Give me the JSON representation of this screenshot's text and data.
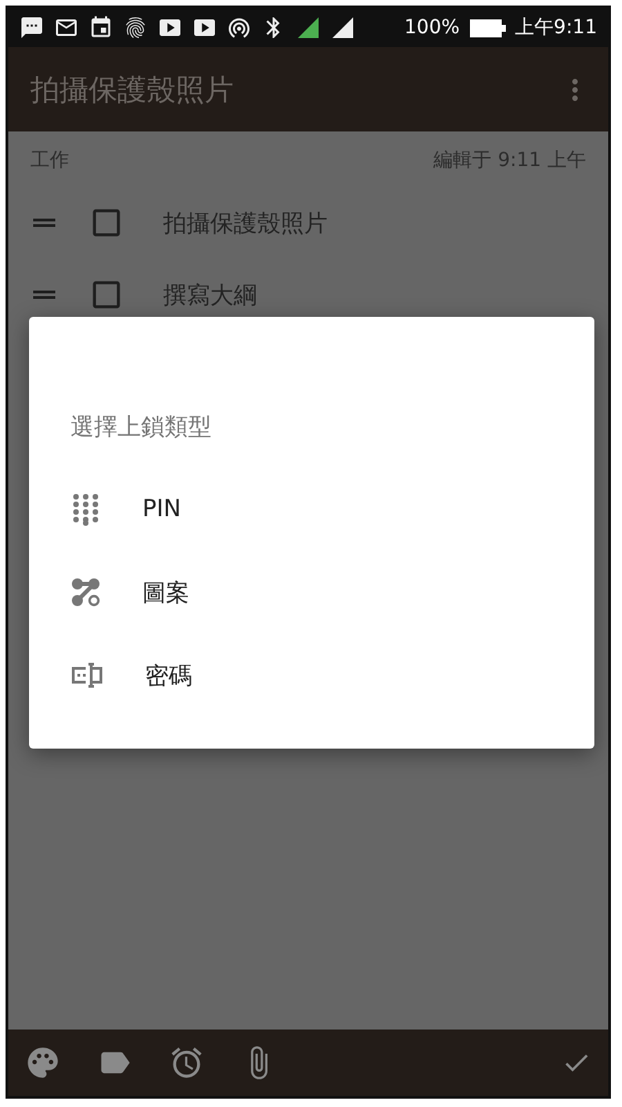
{
  "status_bar": {
    "battery": "100%",
    "time": "上午9:11"
  },
  "app_bar": {
    "title": "拍攝保護殼照片"
  },
  "note": {
    "label": "工作",
    "edited": "編輯于 9:11 上午",
    "items": [
      {
        "text": "拍攝保護殼照片",
        "checked": false
      },
      {
        "text": "撰寫大綱",
        "checked": false
      }
    ]
  },
  "dialog": {
    "title": "選擇上鎖類型",
    "options": [
      {
        "label": "PIN",
        "kind": "pin"
      },
      {
        "label": "圖案",
        "kind": "pattern"
      },
      {
        "label": "密碼",
        "kind": "password"
      }
    ]
  }
}
